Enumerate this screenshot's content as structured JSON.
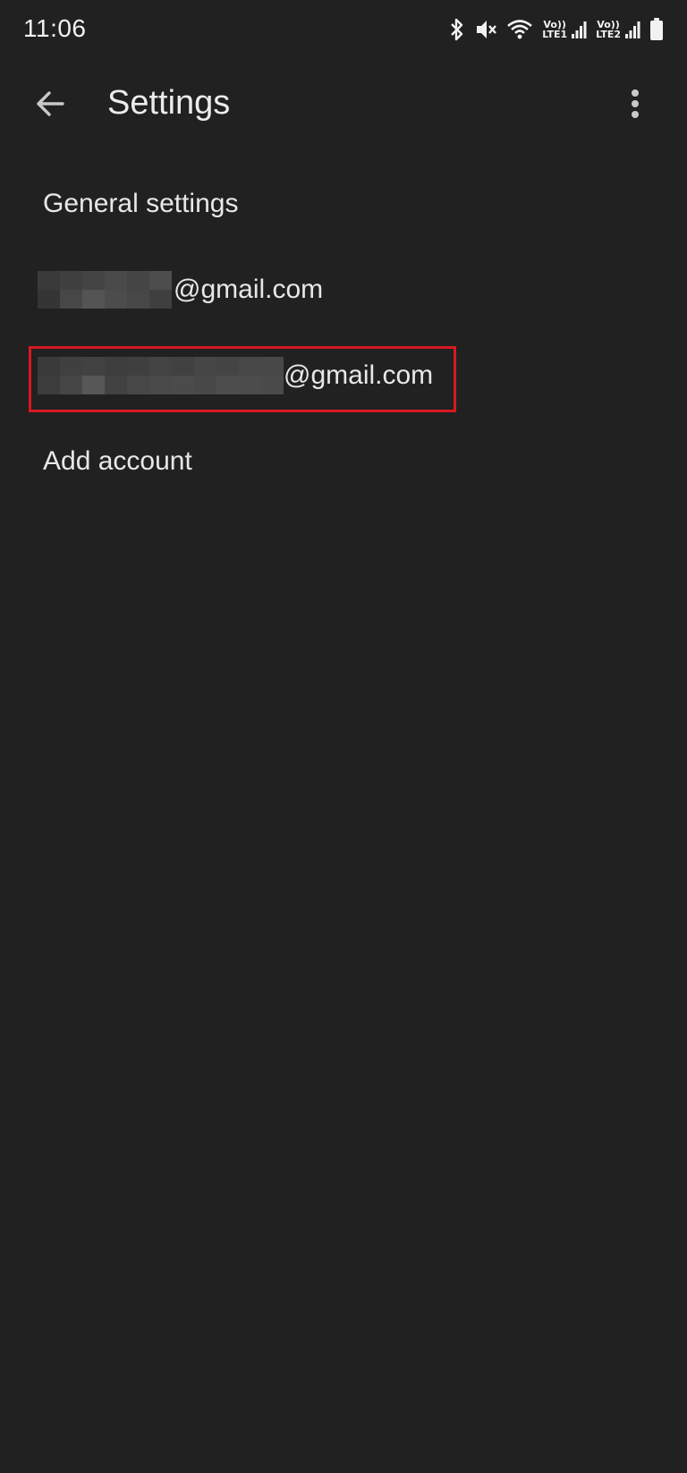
{
  "status_bar": {
    "time": "11:06",
    "icons": [
      "bluetooth-icon",
      "mute-icon",
      "wifi-icon",
      "volte-lte1-icon",
      "signal1-icon",
      "volte-lte2-icon",
      "signal2-icon",
      "battery-icon"
    ],
    "lte1_top": "Vo))",
    "lte1_bottom": "LTE1",
    "lte2_top": "Vo))",
    "lte2_bottom": "LTE2"
  },
  "app_bar": {
    "title": "Settings",
    "back_icon": "arrow-back-icon",
    "more_icon": "more-vert-icon"
  },
  "list": {
    "general_settings": "General settings",
    "account1_suffix": "@gmail.com",
    "account2_suffix": "@gmail.com",
    "add_account": "Add account"
  },
  "colors": {
    "background": "#212121",
    "text": "#e8e8e8",
    "highlight": "#d71920"
  }
}
